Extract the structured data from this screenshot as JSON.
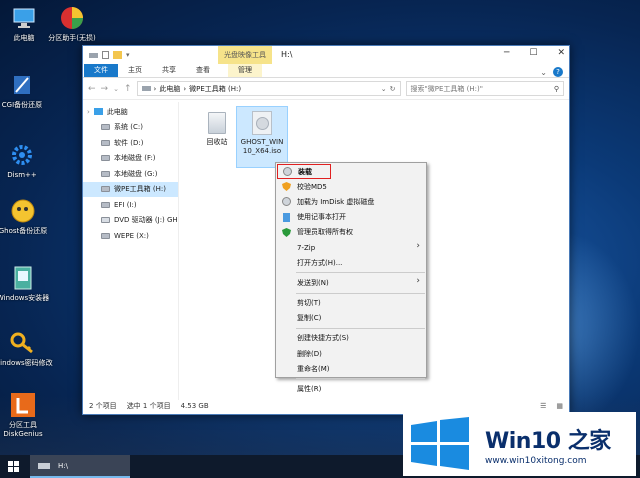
{
  "desktop": {
    "icons": [
      {
        "label": "此电脑"
      },
      {
        "label": "分区助手(无损)"
      },
      {
        "label": "CGI备份还原"
      },
      {
        "label": "Dism++"
      },
      {
        "label": "Ghost备份还原"
      },
      {
        "label": "Windows安装器"
      },
      {
        "label": "Windows密码修改"
      },
      {
        "label": "分区工具DiskGenius"
      }
    ]
  },
  "window": {
    "title": "H:\\",
    "manage_context": "光盘映像工具",
    "ribbon_tabs": [
      "文件",
      "主页",
      "共享",
      "查看",
      "管理"
    ],
    "address": [
      "此电脑",
      "微PE工具箱 (H:)"
    ],
    "search_placeholder": "搜索\"微PE工具箱 (H:)\"",
    "tree": [
      {
        "label": "此电脑"
      },
      {
        "label": "系统 (C:)"
      },
      {
        "label": "软件 (D:)"
      },
      {
        "label": "本地磁盘 (F:)"
      },
      {
        "label": "本地磁盘 (G:)"
      },
      {
        "label": "微PE工具箱 (H:)"
      },
      {
        "label": "EFI (I:)"
      },
      {
        "label": "DVD 驱动器 (J:) GH"
      },
      {
        "label": "WEPE (X:)"
      }
    ],
    "files": [
      {
        "label": "回收站"
      },
      {
        "label": "GHOST_WIN10_X64.iso"
      }
    ],
    "status": {
      "count": "2 个项目",
      "selected": "选中 1 个项目",
      "size": "4.53 GB"
    }
  },
  "context_menu": [
    {
      "label": "装载",
      "icon": "disc-icon"
    },
    {
      "label": "校验MD5",
      "icon": "shield-icon"
    },
    {
      "label": "加载为 ImDisk 虚拟磁盘",
      "icon": "disc-icon"
    },
    {
      "label": "使用记事本打开",
      "icon": "notepad-icon"
    },
    {
      "label": "管理员取得所有权",
      "icon": "shield-check-icon"
    },
    {
      "label": "7-Zip"
    },
    {
      "label": "打开方式(H)..."
    },
    {
      "label": "发送到(N)"
    },
    {
      "label": "剪切(T)"
    },
    {
      "label": "复制(C)"
    },
    {
      "label": "创建快捷方式(S)"
    },
    {
      "label": "删除(D)"
    },
    {
      "label": "重命名(M)"
    },
    {
      "label": "属性(R)"
    }
  ],
  "taskbar": {
    "item": "H:\\"
  },
  "watermark": {
    "brand": "Win10",
    "brand2": "之家",
    "url": "www.win10xitong.com"
  },
  "colors": {
    "accent": "#1979ca",
    "highlight_box": "#e02020"
  }
}
